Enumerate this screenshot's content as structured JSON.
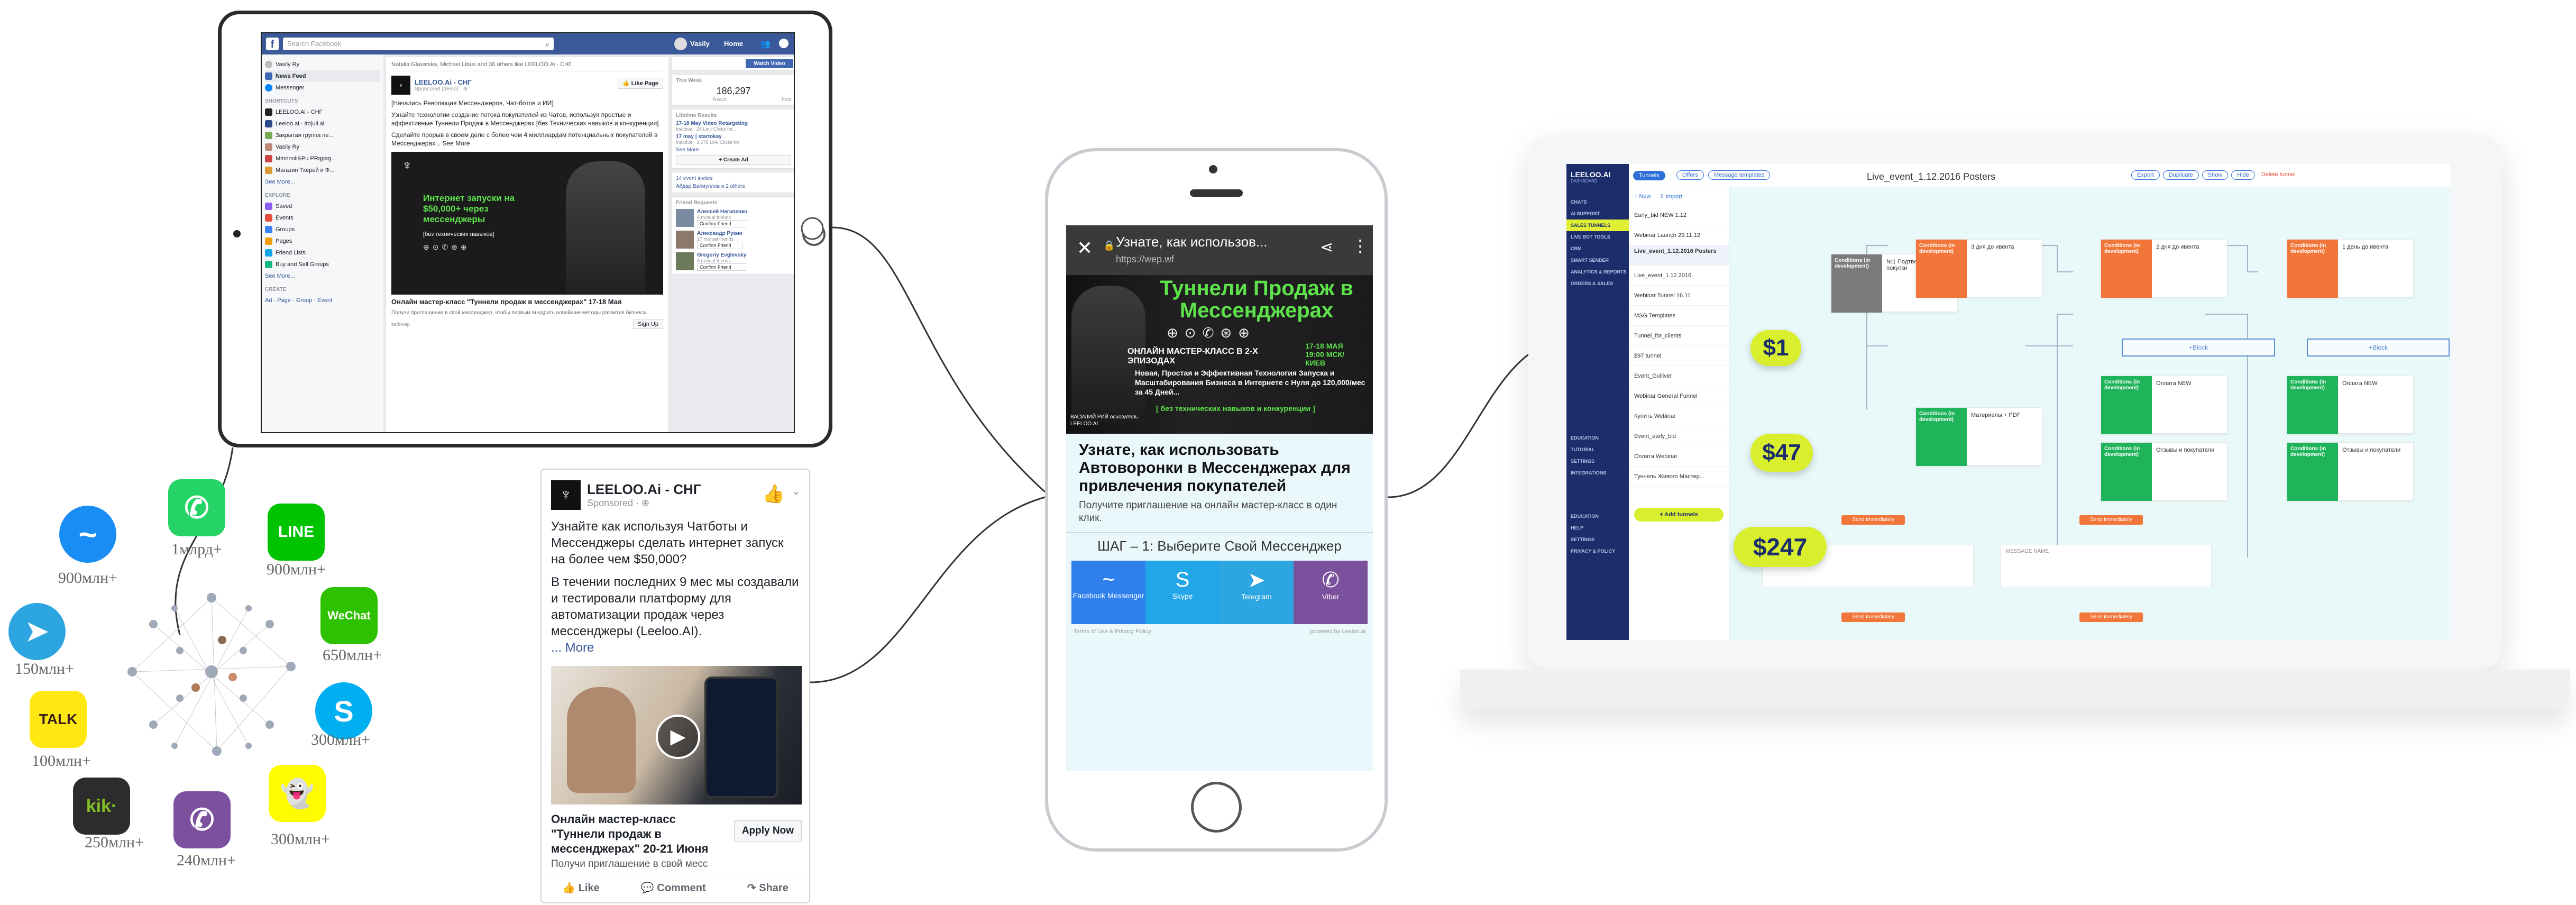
{
  "facebook": {
    "search_placeholder": "Search Facebook",
    "user": "Vasily",
    "nav_home": "Home",
    "left_menu": {
      "profile": "Vasily Ry",
      "news_feed": "News Feed",
      "messenger": "Messenger",
      "shortcuts_title": "SHORTCUTS",
      "shortcuts": [
        "LEELOO.Ai - СНГ",
        "Leeloo.ai - Ito|uli.ai",
        "Закрытая группа пе...",
        "Vasily Ry",
        "Mmonoli&Pu PRqpag...",
        "Магазин Тхерей и Ф..."
      ],
      "see_more": "See More...",
      "explore_title": "EXPLORE",
      "explore": [
        "Saved",
        "Events",
        "Groups",
        "Pages",
        "Friend Lists",
        "Buy and Sell Groups"
      ],
      "create_title": "CREATE",
      "create_links": "Ad · Page · Group · Event"
    },
    "post": {
      "liked_by": "Natalia Glavatska, Michael Libus and 36 others like LEELOO.Ai - СНГ.",
      "page_name": "LEELOO.Ai - СНГ",
      "sponsored": "Sponsored (demo) · ⊕",
      "like_page": "Like Page",
      "text1": "[Начались Революция Мессенджеров, Чат-ботов и ИИ]",
      "text2": "Узнайте технологии создание потока покупателей из Чатов, используя простые и эффективные Туннели Продаж в Мессенджерах [без Технических навыков и конкуренции]",
      "text3": "Сделайте прорыв в своем деле с более чем 4 миллиардам потенциальных покупателей в Мессенджерах... See More",
      "image_text": "Интернет запуски на $50,000+ через мессенджеры",
      "image_sub": "[без технических навыков]",
      "headline": "Онлайн мастер-класс \"Туннели продаж в мессенджерах\" 17-18 Мая",
      "desc": "Получи приглашение в свой мессенджер, чтобы первым внедрить новейшие методы развития бизнеса...",
      "domain": "вебинар",
      "signup": "Sign Up"
    },
    "right": {
      "watch_video": "Watch Video",
      "this_week": "This Week",
      "reach_num": "186,297",
      "reach_lbl": "Reach",
      "post_lbl": "Post",
      "lifetime": "Lifetime Results",
      "r1": "17-18 May Video Retargeting",
      "r1s": "Inactive · 28 Link Clicks for...",
      "r2": "17 may | startokay",
      "r2s": "Inactive · 3,678 Link Clicks for",
      "see_more": "See More",
      "create_ad": "+ Create Ad",
      "invites": "14 event invites",
      "birthday": "Айдар Валиуллов и 2 others",
      "friend_requests": "Friend Requests",
      "friends": [
        {
          "name": "Алексей Нагапенко",
          "mutual": "6 mutual friends",
          "btn": "Confirm Friend"
        },
        {
          "name": "Александр Рукин",
          "mutual": "17 mutual friends",
          "btn": "Confirm Friend"
        },
        {
          "name": "Gregoriy Evglevsky",
          "mutual": "8 mutual friends",
          "btn": "Confirm Friend"
        }
      ]
    }
  },
  "messengers": [
    {
      "name": "messenger",
      "label": "900млн+",
      "color": "#1a8df5",
      "glyph": "~"
    },
    {
      "name": "whatsapp",
      "label": "1млрд+",
      "color": "#25d366",
      "glyph": "✆"
    },
    {
      "name": "line",
      "label": "900млн+",
      "color": "#00c300",
      "glyph": "LINE"
    },
    {
      "name": "telegram",
      "label": "150млн+",
      "color": "#2ca5e0",
      "glyph": "➤"
    },
    {
      "name": "wechat",
      "label": "650млн+",
      "color": "#2dc100",
      "glyph": "WeChat"
    },
    {
      "name": "kakaotalk",
      "label": "100млн+",
      "color": "#ffe812",
      "glyph": "TALK"
    },
    {
      "name": "skype",
      "label": "300млн+",
      "color": "#00aff0",
      "glyph": "S"
    },
    {
      "name": "kik",
      "label": "250млн+",
      "color": "#2c2c2c",
      "glyph": "kik·"
    },
    {
      "name": "viber",
      "label": "240млн+",
      "color": "#7b519d",
      "glyph": "✆"
    },
    {
      "name": "snapchat",
      "label": "300млн+",
      "color": "#fffc00",
      "glyph": "👻"
    }
  ],
  "ad": {
    "page_name": "LEELOO.Ai - СНГ",
    "sponsored": "Sponsored · ⊕",
    "text1": "Узнайте как используя Чатботы и Мессенджеры сделать интернет запуск на более чем $50,000?",
    "text2": "В течении последних 9 мес мы создавали и тестировали платформу для автоматизации продаж через мессенджеры (Leeloo.AI).",
    "more": "... More",
    "headline": "Онлайн мастер-класс \"Туннели продаж в мессенджерах\" 20-21 Июня",
    "desc": "Получи приглашение в свой месс",
    "apply": "Apply Now",
    "like": "Like",
    "comment": "Comment",
    "share": "Share"
  },
  "phone": {
    "title": "Узнате, как использов...",
    "url": "https://wep.wf",
    "banner_title": "Туннели Продаж в Мессенджерах",
    "banner_sub": "ОНЛАЙН МАСТЕР-КЛАСС В 2-Х ЭПИЗОДАХ",
    "banner_date": "17-18 МАЯ 19:00 МСК/КИЕВ",
    "banner_desc": "Новая, Простая и Эффективная Технология Запуска и Масштабирования Бизнеса в Интернете с Нуля до 120,000/мес за 45 Дней...",
    "banner_note": "[ без технических навыков и конкуренции ]",
    "speaker": "ВАСИЛИЙ РИЙ основатель LEELOO.AI",
    "headline": "Узнате, как использовать Автоворонки в Мессенджерах для привлечения покупателей",
    "sub": "Получите приглашение на онлайн мастер-класс в один клик.",
    "step": "ШАГ – 1: Выберите Свой Мессенджер",
    "buttons": [
      {
        "label": "Facebook Messenger",
        "color": "#2f80ed",
        "glyph": "~"
      },
      {
        "label": "Skype",
        "color": "#22a6e8",
        "glyph": "S"
      },
      {
        "label": "Telegram",
        "color": "#2ca5e0",
        "glyph": "➤"
      },
      {
        "label": "Viber",
        "color": "#7b519d",
        "glyph": "✆"
      }
    ],
    "footer_left": "Terms of Use & Privacy Policy",
    "footer_right": "powered by Leeloo.ai"
  },
  "dashboard": {
    "brand": "LEELOO.AI",
    "brand_sub": "DASHBOARD",
    "side_items": [
      "CHATS",
      "AI SUPPORT",
      "SALES TUNNELS",
      "LIVE BOT TOOLS",
      "CRM",
      "SMART SENDER",
      "ANALYTICS & REPORTS",
      "ORDERS & SALES"
    ],
    "side_bottom": [
      "EDUCATION",
      "TUTORIAL",
      "SETTINGS",
      "INTEGRATIONS",
      "EDUCATION",
      "HELP",
      "SETTINGS",
      "PRIVACY & POLICY"
    ],
    "tabs": [
      "Tunnels",
      "Offers",
      "Message templates"
    ],
    "new": "+ New",
    "import": "⇩ Import",
    "list": [
      "Early_bid NEW 1.12",
      "Webinar Launch 29.11.12",
      "Live_event_1.12.2016 Posters",
      "Live_event_1.12.2016",
      "Webinar Tunnel 16.11",
      "MSG Templates",
      "Tunnel_for_clients",
      "$97 tunnel",
      "Event_Gulliver",
      "Webinar General Funnel",
      "Купить Webinar",
      "Event_early_bid",
      "Оплата Webinar",
      "Туннель Живого Мастер..."
    ],
    "add_tunnel": "+ Add tunnels",
    "title": "Live_event_1.12.2016 Posters",
    "actions": [
      "Export",
      "Duplicate",
      "Show",
      "Hide"
    ],
    "delete": "Delete tunnel",
    "prices": [
      "$1",
      "$47",
      "$247"
    ],
    "conditions": "Conditions (in development)",
    "step1": "3 дня до ивента",
    "step2": "2 дня до ивента",
    "step3": "1 день до ивента",
    "pdf": "Материалы + PDF",
    "offer": "Оплата NEW",
    "upsell": "Отзывы и покупатели",
    "first": "№1 Подтверждение покупки",
    "block": "+Block",
    "send": "Send immediately",
    "msg_name": "MESSAGE NAME"
  }
}
